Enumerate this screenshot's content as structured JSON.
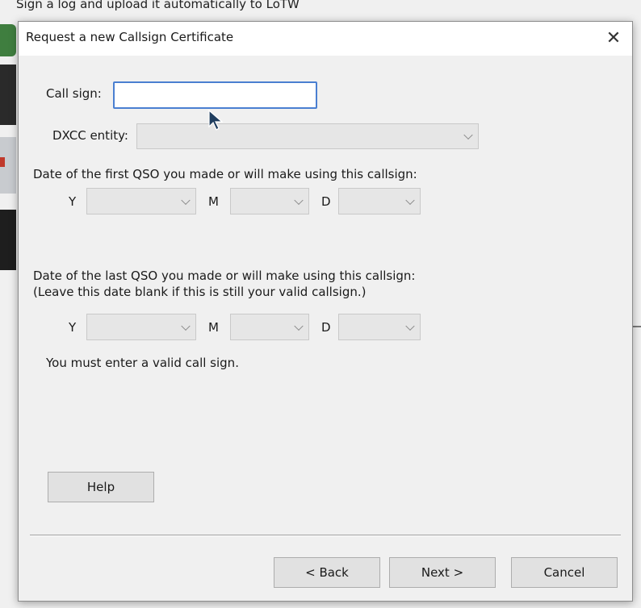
{
  "background": {
    "caption": "Sign a log and upload it automatically to LoTW"
  },
  "dialog": {
    "title": "Request a new Callsign Certificate",
    "close_glyph": "✕",
    "callsign": {
      "label": "Call sign:",
      "value": ""
    },
    "dxcc": {
      "label": "DXCC entity:",
      "value": ""
    },
    "first_qso": {
      "heading": "Date of the first QSO you made or will make using this callsign:",
      "year_label": "Y",
      "month_label": "M",
      "day_label": "D",
      "year": "",
      "month": "",
      "day": ""
    },
    "last_qso": {
      "heading": "Date of the last QSO you made or will make using this callsign:",
      "note": "(Leave this date blank if this is still your valid callsign.)",
      "year_label": "Y",
      "month_label": "M",
      "day_label": "D",
      "year": "",
      "month": "",
      "day": ""
    },
    "validation_message": "You must enter a valid call sign.",
    "buttons": {
      "help": "Help",
      "back": "< Back",
      "next": "Next >",
      "cancel": "Cancel"
    }
  }
}
